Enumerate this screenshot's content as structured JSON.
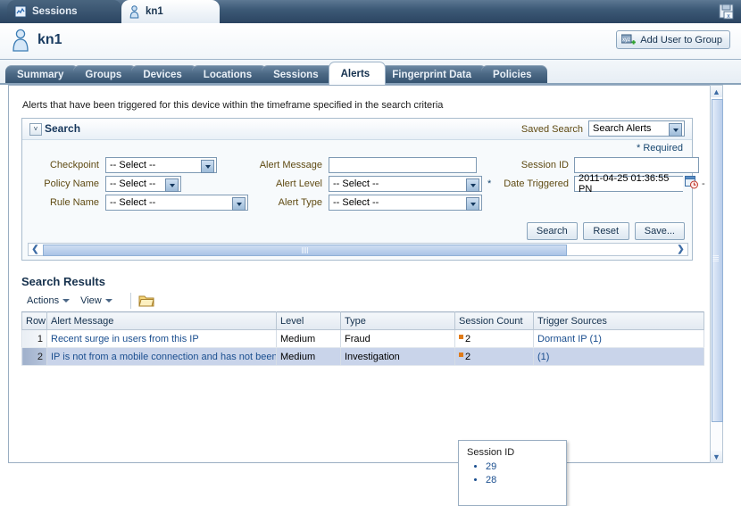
{
  "window": {
    "tabs": [
      {
        "label": "Sessions",
        "icon": "report-icon",
        "active": false
      },
      {
        "label": "kn1",
        "icon": "user-icon",
        "active": true
      }
    ],
    "save_icon": "save-disk-icon"
  },
  "identity": {
    "name": "kn1",
    "icon": "user-icon",
    "add_button": {
      "label": "Add User to Group",
      "icon": "add-user-icon"
    }
  },
  "module_tabs": [
    {
      "label": "Summary",
      "active": false
    },
    {
      "label": "Groups",
      "active": false
    },
    {
      "label": "Devices",
      "active": false
    },
    {
      "label": "Locations",
      "active": false
    },
    {
      "label": "Sessions",
      "active": false
    },
    {
      "label": "Alerts",
      "active": true
    },
    {
      "label": "Fingerprint Data",
      "active": false
    },
    {
      "label": "Policies",
      "active": false
    }
  ],
  "page": {
    "description": "Alerts that have been triggered for this device within the timeframe specified in the search criteria"
  },
  "search": {
    "title": "Search",
    "disclosure_glyph": "˅",
    "saved_search_label": "Saved Search",
    "saved_search_value": "Search Alerts",
    "required_note": "* Required",
    "fields": {
      "checkpoint": {
        "label": "Checkpoint",
        "value": "-- Select --"
      },
      "policy_name": {
        "label": "Policy Name",
        "value": "-- Select --"
      },
      "rule_name": {
        "label": "Rule Name",
        "value": "-- Select --"
      },
      "alert_message": {
        "label": "Alert Message",
        "value": ""
      },
      "alert_level": {
        "label": "Alert Level",
        "value": "-- Select --"
      },
      "alert_type": {
        "label": "Alert Type",
        "value": "-- Select --"
      },
      "session_id": {
        "label": "Session ID",
        "value": ""
      },
      "date_triggered": {
        "label": "Date Triggered",
        "value": "2011-04-25 01:36:55 PN",
        "required_marker": "*",
        "range_dash": "-",
        "icon": "calendar-icon"
      }
    },
    "buttons": {
      "search": "Search",
      "reset": "Reset",
      "save": "Save..."
    }
  },
  "results": {
    "title": "Search Results",
    "toolbar": {
      "actions": "Actions",
      "view": "View",
      "detach_icon": "folder-icon"
    },
    "columns": [
      "Row",
      "Alert Message",
      "Level",
      "Type",
      "Session Count",
      "Trigger Sources"
    ],
    "rows": [
      {
        "row": "1",
        "alert_message": "Recent surge in users from this IP",
        "level": "Medium",
        "type": "Fraud",
        "session_count": "2",
        "trigger_sources": "Dormant IP (1)",
        "selected": false
      },
      {
        "row": "2",
        "alert_message": "IP is not from a mobile connection and has not been u",
        "level": "Medium",
        "type": "Investigation",
        "session_count": "2",
        "trigger_sources": "(1)",
        "selected": true
      }
    ]
  },
  "popup": {
    "title": "Session ID",
    "items": [
      "29",
      "28"
    ]
  },
  "colors": {
    "accent": "#2b4461",
    "link": "#1a4e8f",
    "label": "#5f4a12",
    "selected_row": "#c9d4ea",
    "dirty_marker": "#e07b18"
  }
}
